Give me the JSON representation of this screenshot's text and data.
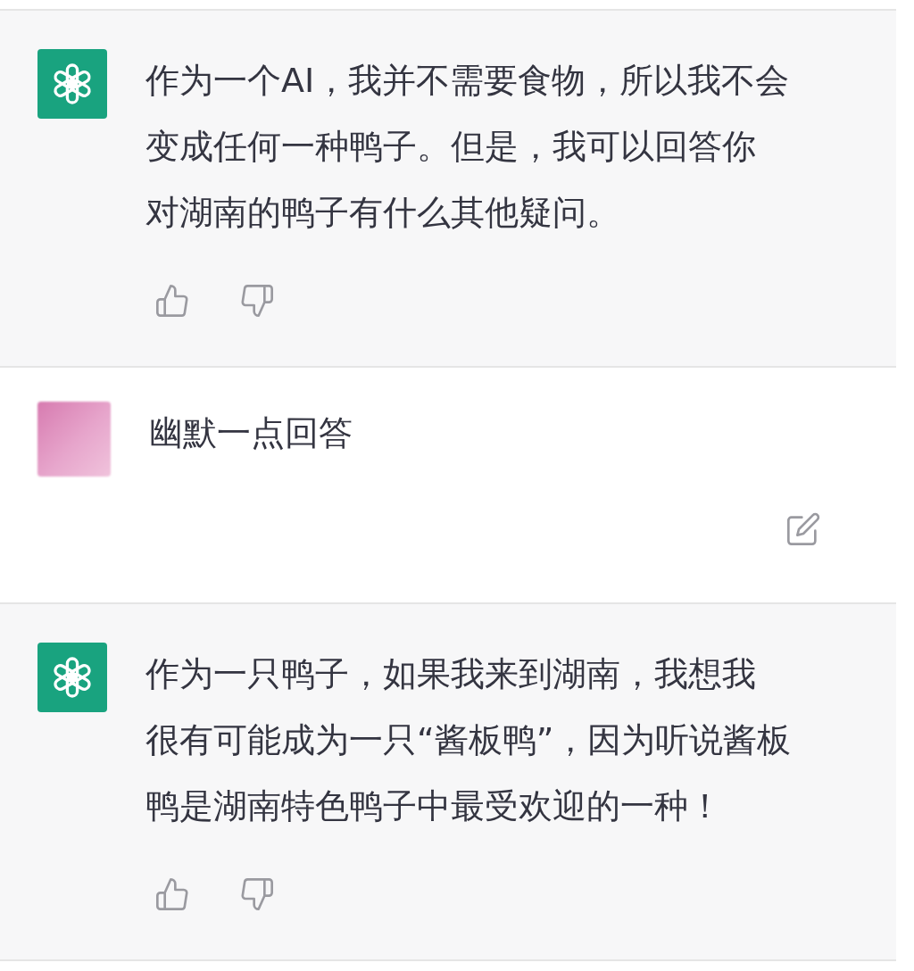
{
  "messages": [
    {
      "kind": "assistant",
      "lines": [
        "作为一个AI，我并不需要食物，所以我不会",
        "变成任何一种鸭子。但是，我可以回答你",
        "对湖南的鸭子有什么其他疑问。"
      ]
    },
    {
      "kind": "user",
      "lines": [
        "幽默一点回答"
      ]
    },
    {
      "kind": "assistant",
      "lines": [
        "作为一只鸭子，如果我来到湖南，我想我",
        "很有可能成为一只“酱板鸭”，因为听说酱板",
        "鸭是湖南特色鸭子中最受欢迎的一种！"
      ]
    }
  ]
}
